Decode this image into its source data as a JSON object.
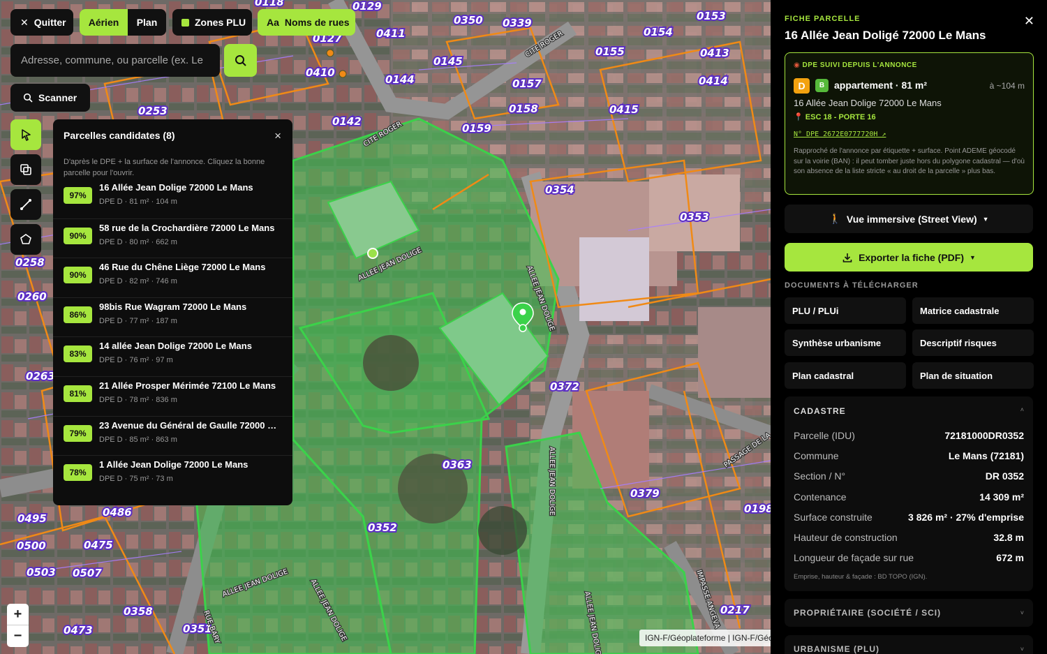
{
  "toolbar": {
    "quit": "Quitter",
    "aerial": "Aérien",
    "plan": "Plan",
    "zones": "Zones PLU",
    "names_prefix": "Aa",
    "names": "Noms de rues"
  },
  "search": {
    "placeholder": "Adresse, commune, ou parcelle (ex. Le",
    "scan": "Scanner"
  },
  "candidates": {
    "title": "Parcelles candidates (8)",
    "description": "D'après le DPE + la surface de l'annonce. Cliquez la bonne parcelle pour l'ouvrir.",
    "items": [
      {
        "score": "97%",
        "address": "16 Allée Jean Dolige 72000 Le Mans",
        "meta": "DPE D · 81 m² · 104 m"
      },
      {
        "score": "90%",
        "address": "58 rue de la Crochardière 72000 Le Mans",
        "meta": "DPE D · 80 m² · 662 m"
      },
      {
        "score": "90%",
        "address": "46 Rue du Chêne Liège 72000 Le Mans",
        "meta": "DPE D · 82 m² · 746 m"
      },
      {
        "score": "86%",
        "address": "98bis Rue Wagram 72000 Le Mans",
        "meta": "DPE D · 77 m² · 187 m"
      },
      {
        "score": "83%",
        "address": "14 allée Jean Dolige 72000 Le Mans",
        "meta": "DPE D · 76 m² · 97 m"
      },
      {
        "score": "81%",
        "address": "21 Allée Prosper Mérimée 72100 Le Mans",
        "meta": "DPE D · 78 m² · 836 m"
      },
      {
        "score": "79%",
        "address": "23 Avenue du Général de Gaulle 72000 …",
        "meta": "DPE D · 85 m² · 863 m"
      },
      {
        "score": "78%",
        "address": "1 Allée Jean Dolige 72000 Le Mans",
        "meta": "DPE D · 75 m² · 73 m"
      }
    ]
  },
  "map": {
    "attribution": "IGN-F/Géoplateforme | IGN-F/Géoplateforme",
    "zoom_in": "+",
    "zoom_out": "−",
    "parcels": [
      "0118",
      "0129",
      "0350",
      "0339",
      "0153",
      "0127",
      "0411",
      "0154",
      "0413",
      "0410",
      "0145",
      "0155",
      "0414",
      "0144",
      "0157",
      "0253",
      "0158",
      "0415",
      "0142",
      "0159",
      "0354",
      "0353",
      "0258",
      "0260",
      "0372",
      "0363",
      "0379",
      "0352",
      "0486",
      "0495",
      "0475",
      "0500",
      "0503",
      "0507",
      "0358",
      "0473",
      "0217",
      "0198",
      "0263",
      "0351"
    ],
    "streets": [
      "CITE ROGER",
      "CITE ROGER",
      "ALLEE JEAN DOLIGE",
      "ALLEE JEAN DOLIGE",
      "ALLEE JEAN DOLIGE",
      "ALLEE JEAN DOLIGE",
      "ALLEE JEAN DOLIGE",
      "ALLEE JEAN DOLIGE",
      "PASSAGE DE LA",
      "IMPASSE ANGEVA",
      "RUE BARY"
    ]
  },
  "sheet": {
    "kicker": "FICHE PARCELLE",
    "title": "16 Allée Jean Doligé 72000 Le Mans",
    "dpe": {
      "kicker": "DPE SUIVI DEPUIS L'ANNONCE",
      "letter_main": "D",
      "letter_secondary": "B",
      "type": "appartement · 81 m²",
      "distance": "à ~104 m",
      "address": "16 Allée Jean Dolige 72000 Le Mans",
      "door": "ESC 18 - PORTE 16",
      "number": "N° DPE 2672E0777720H ↗",
      "note": "Rapproché de l'annonce par étiquette + surface. Point ADEME géocodé sur la voirie (BAN) : il peut tomber juste hors du polygone cadastral — d'où son absence de la liste stricte « au droit de la parcelle » plus bas."
    },
    "street_view": "Vue immersive (Street View)",
    "export": "Exporter la fiche (PDF)",
    "docs_title": "DOCUMENTS À TÉLÉCHARGER",
    "docs": [
      "PLU / PLUi",
      "Matrice cadastrale",
      "Synthèse urbanisme",
      "Descriptif risques",
      "Plan cadastral",
      "Plan de situation"
    ],
    "cadastre": {
      "title": "CADASTRE",
      "rows": [
        {
          "k": "Parcelle (IDU)",
          "v": "72181000DR0352"
        },
        {
          "k": "Commune",
          "v": "Le Mans (72181)"
        },
        {
          "k": "Section / N°",
          "v": "DR 0352"
        },
        {
          "k": "Contenance",
          "v": "14 309 m²"
        },
        {
          "k": "Surface construite",
          "v": "3 826 m² · 27% d'emprise"
        },
        {
          "k": "Hauteur de construction",
          "v": "32.8 m"
        },
        {
          "k": "Longueur de façade sur rue",
          "v": "672 m"
        }
      ],
      "source": "Emprise, hauteur & façade : BD TOPO (IGN)."
    },
    "owner_title": "PROPRIÉTAIRE (SOCIÉTÉ / SCI)",
    "urbanism_title": "URBANISME (PLU)"
  },
  "colors": {
    "accent": "#a6e63e",
    "parcel_label": "#5b2ec4",
    "dpe_d": "#f3a20f",
    "dpe_b": "#56b93a"
  }
}
